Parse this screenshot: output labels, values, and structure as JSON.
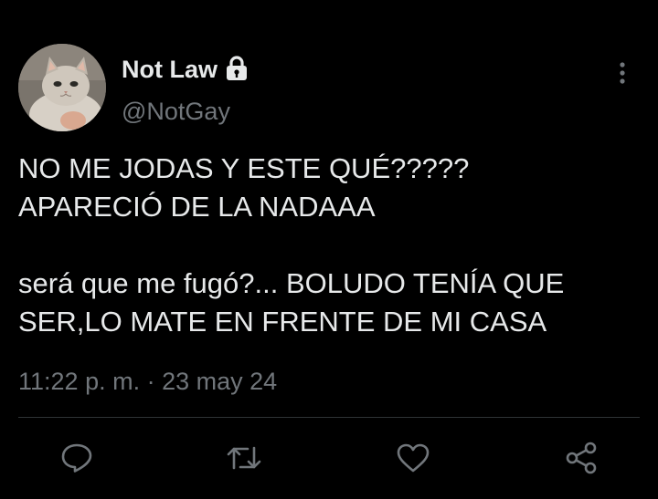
{
  "author": {
    "display_name": "Not Law",
    "handle": "@NotGay",
    "protected_icon": "lock-icon",
    "avatar": "cat-avatar"
  },
  "tweet": {
    "paragraphs": [
      "NO ME JODAS Y ESTE QUÉ?????\nAPARECIÓ DE LA NADAAA",
      "será que me fugó?... BOLUDO TENÍA QUE SER,LO MATE EN FRENTE DE MI CASA"
    ],
    "time": "11:22 p. m.",
    "separator": "·",
    "date": "23 may 24"
  },
  "actions": [
    "reply-icon",
    "retweet-icon",
    "like-icon",
    "share-icon"
  ],
  "colors": {
    "background": "#000000",
    "text": "#e7e9ea",
    "secondary": "#71767b",
    "divider": "#2f3336"
  }
}
